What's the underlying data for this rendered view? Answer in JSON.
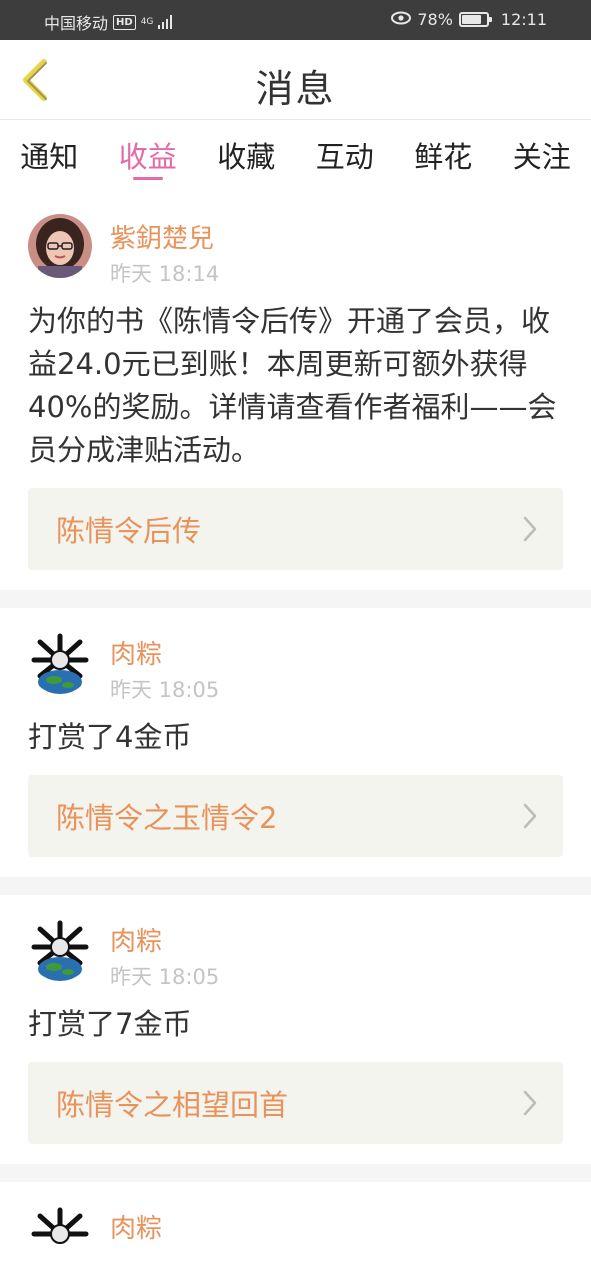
{
  "status_bar": {
    "carrier": "中国移动",
    "hd": "HD",
    "network": "4G",
    "battery": "78%",
    "battery_level": 0.78,
    "time": "12:11"
  },
  "header": {
    "title": "消息",
    "back_icon": "chevron-left-icon"
  },
  "tabs": [
    {
      "label": "通知",
      "active": false
    },
    {
      "label": "收益",
      "active": true
    },
    {
      "label": "收藏",
      "active": false
    },
    {
      "label": "互动",
      "active": false
    },
    {
      "label": "鲜花",
      "active": false
    },
    {
      "label": "关注",
      "active": false
    }
  ],
  "colors": {
    "accent": "#e46aa6",
    "name_orange": "#e8935c",
    "time_gray": "#c4c4c4",
    "link_bg": "#f4f4ee",
    "status_bg": "#3d3d3d"
  },
  "messages": [
    {
      "user": "紫鈅楚兒",
      "time": "昨天 18:14",
      "text": "为你的书《陈情令后传》开通了会员，收益24.0元已到账！本周更新可额外获得40%的奖励。详情请查看作者福利——会员分成津贴活动。",
      "link": "陈情令后传"
    },
    {
      "user": "肉粽",
      "time": "昨天 18:05",
      "text": "打赏了4金币",
      "link": "陈情令之玉情令2"
    },
    {
      "user": "肉粽",
      "time": "昨天 18:05",
      "text": "打赏了7金币",
      "link": "陈情令之相望回首"
    },
    {
      "user": "肉粽",
      "time": "",
      "text": "",
      "link": ""
    }
  ]
}
